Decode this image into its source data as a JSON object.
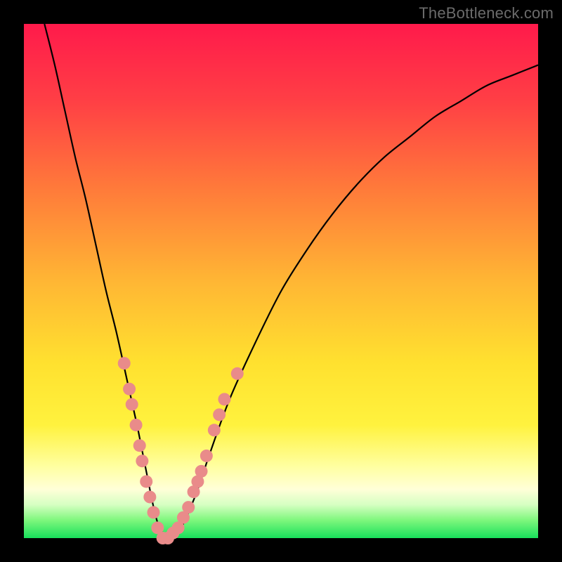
{
  "watermark": "TheBottleneck.com",
  "gradient_stops": [
    {
      "offset": 0.0,
      "color": "#ff1a4b"
    },
    {
      "offset": 0.15,
      "color": "#ff3f45"
    },
    {
      "offset": 0.32,
      "color": "#ff7a3a"
    },
    {
      "offset": 0.5,
      "color": "#ffb634"
    },
    {
      "offset": 0.66,
      "color": "#ffe12f"
    },
    {
      "offset": 0.78,
      "color": "#fff23e"
    },
    {
      "offset": 0.86,
      "color": "#ffffa0"
    },
    {
      "offset": 0.905,
      "color": "#ffffd8"
    },
    {
      "offset": 0.935,
      "color": "#d6ffc2"
    },
    {
      "offset": 0.965,
      "color": "#7ef77d"
    },
    {
      "offset": 1.0,
      "color": "#18e05b"
    }
  ],
  "chart_data": {
    "type": "line",
    "title": "",
    "xlabel": "",
    "ylabel": "",
    "xlim": [
      0,
      100
    ],
    "ylim": [
      0,
      100
    ],
    "series": [
      {
        "name": "bottleneck-curve",
        "x": [
          4,
          6,
          8,
          10,
          12,
          14,
          16,
          18,
          20,
          22,
          23,
          24,
          25,
          26,
          27,
          28,
          30,
          32,
          34,
          36,
          40,
          45,
          50,
          55,
          60,
          65,
          70,
          75,
          80,
          85,
          90,
          95,
          100
        ],
        "y": [
          100,
          92,
          83,
          74,
          66,
          57,
          48,
          40,
          31,
          22,
          17,
          12,
          7,
          3,
          1,
          0,
          1,
          5,
          10,
          16,
          27,
          38,
          48,
          56,
          63,
          69,
          74,
          78,
          82,
          85,
          88,
          90,
          92
        ]
      }
    ],
    "markers": {
      "name": "sample-points",
      "color": "#e98b8a",
      "points": [
        {
          "x": 19.5,
          "y": 34
        },
        {
          "x": 20.5,
          "y": 29
        },
        {
          "x": 21.0,
          "y": 26
        },
        {
          "x": 21.8,
          "y": 22
        },
        {
          "x": 22.5,
          "y": 18
        },
        {
          "x": 23.0,
          "y": 15
        },
        {
          "x": 23.8,
          "y": 11
        },
        {
          "x": 24.5,
          "y": 8
        },
        {
          "x": 25.2,
          "y": 5
        },
        {
          "x": 26.0,
          "y": 2
        },
        {
          "x": 27.0,
          "y": 0
        },
        {
          "x": 28.0,
          "y": 0
        },
        {
          "x": 29.0,
          "y": 1
        },
        {
          "x": 30.0,
          "y": 2
        },
        {
          "x": 31.0,
          "y": 4
        },
        {
          "x": 32.0,
          "y": 6
        },
        {
          "x": 33.0,
          "y": 9
        },
        {
          "x": 33.8,
          "y": 11
        },
        {
          "x": 34.5,
          "y": 13
        },
        {
          "x": 35.5,
          "y": 16
        },
        {
          "x": 37.0,
          "y": 21
        },
        {
          "x": 38.0,
          "y": 24
        },
        {
          "x": 39.0,
          "y": 27
        },
        {
          "x": 41.5,
          "y": 32
        }
      ]
    }
  }
}
